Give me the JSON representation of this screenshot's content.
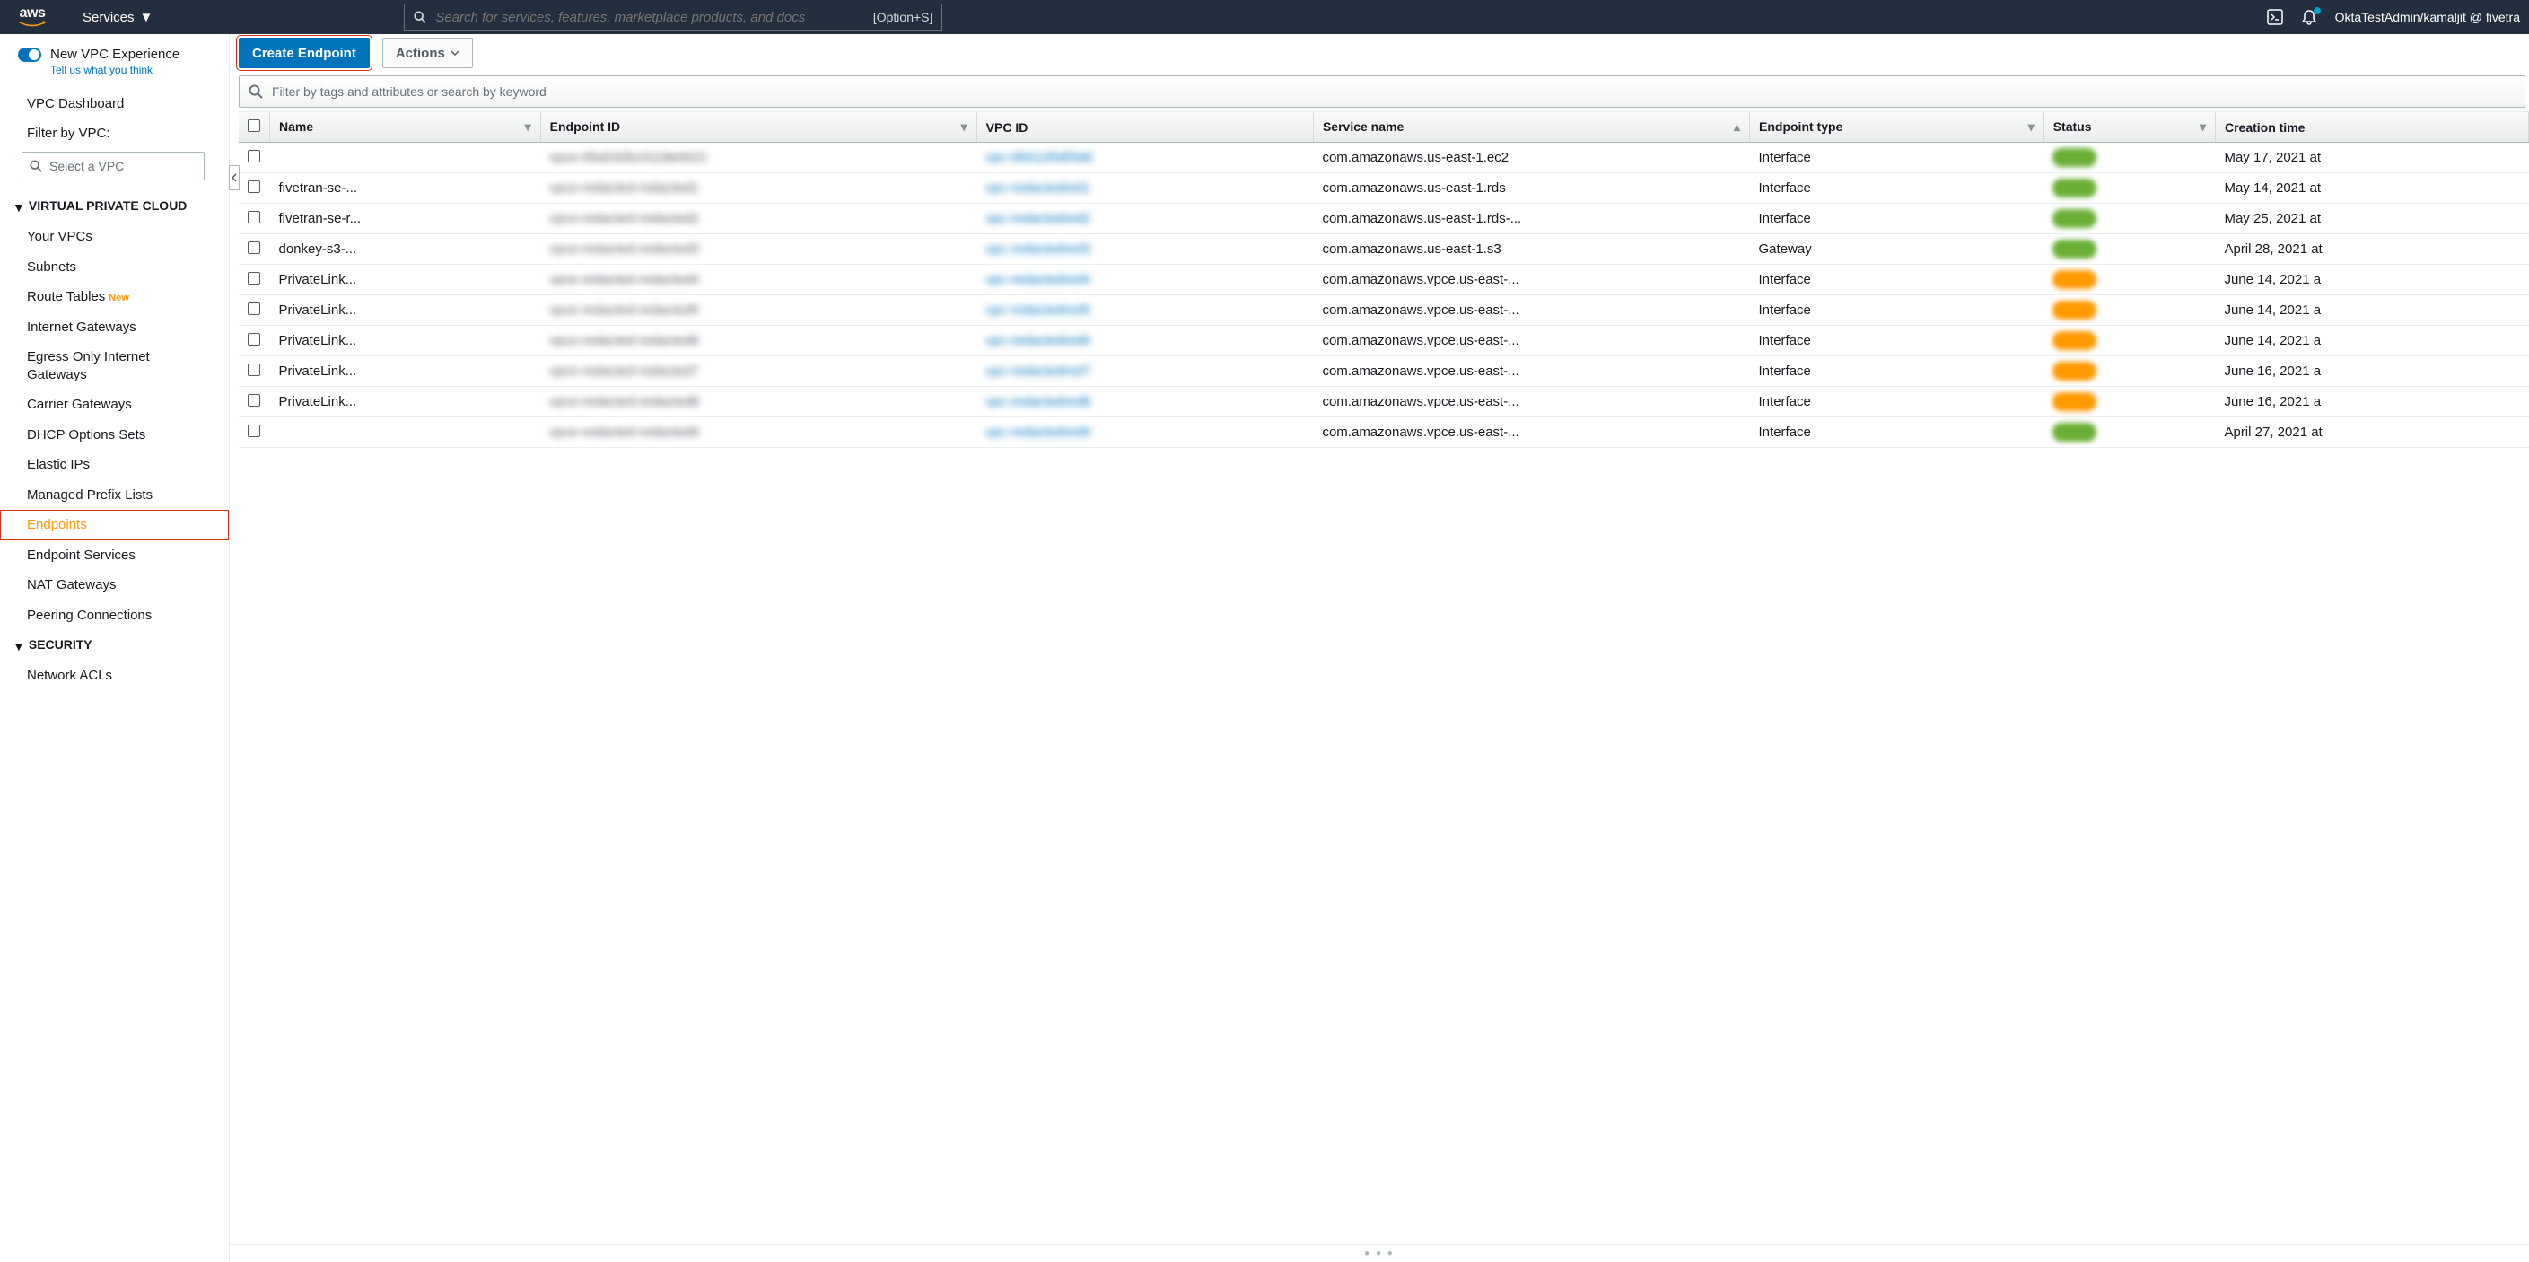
{
  "topnav": {
    "services_label": "Services",
    "search_placeholder": "Search for services, features, marketplace products, and docs",
    "search_shortcut": "[Option+S]",
    "account_label": "OktaTestAdmin/kamaljit @ fivetra"
  },
  "sidebar": {
    "new_experience_label": "New VPC Experience",
    "feedback_label": "Tell us what you think",
    "vpc_dashboard": "VPC Dashboard",
    "filter_by_vpc": "Filter by VPC:",
    "select_vpc_placeholder": "Select a VPC",
    "section_vpc": "VIRTUAL PRIVATE CLOUD",
    "items_vpc": [
      {
        "label": "Your VPCs"
      },
      {
        "label": "Subnets"
      },
      {
        "label": "Route Tables",
        "new": true
      },
      {
        "label": "Internet Gateways"
      },
      {
        "label": "Egress Only Internet Gateways"
      },
      {
        "label": "Carrier Gateways"
      },
      {
        "label": "DHCP Options Sets"
      },
      {
        "label": "Elastic IPs"
      },
      {
        "label": "Managed Prefix Lists"
      },
      {
        "label": "Endpoints",
        "active": true
      },
      {
        "label": "Endpoint Services"
      },
      {
        "label": "NAT Gateways"
      },
      {
        "label": "Peering Connections"
      }
    ],
    "section_security": "SECURITY",
    "items_security": [
      {
        "label": "Network ACLs"
      }
    ],
    "new_badge": "New"
  },
  "actions": {
    "create_endpoint": "Create Endpoint",
    "actions_label": "Actions"
  },
  "filter": {
    "placeholder": "Filter by tags and attributes or search by keyword"
  },
  "table": {
    "headers": {
      "name": "Name",
      "endpoint_id": "Endpoint ID",
      "vpc_id": "VPC ID",
      "service_name": "Service name",
      "endpoint_type": "Endpoint type",
      "status": "Status",
      "creation_time": "Creation time"
    },
    "rows": [
      {
        "name": "",
        "endpoint_id": "vpce-05a532bc0118e0021",
        "vpc_id": "vpc-0b511f0df3dd",
        "service": "com.amazonaws.us-east-1.ec2",
        "type": "Interface",
        "status": "green",
        "created": "May 17, 2021 at"
      },
      {
        "name": "fivetran-se-...",
        "endpoint_id": "vpce-redacted-redacted1",
        "vpc_id": "vpc-redactedred1",
        "service": "com.amazonaws.us-east-1.rds",
        "type": "Interface",
        "status": "green",
        "created": "May 14, 2021 at"
      },
      {
        "name": "fivetran-se-r...",
        "endpoint_id": "vpce-redacted-redacted2",
        "vpc_id": "vpc-redactedred2",
        "service": "com.amazonaws.us-east-1.rds-...",
        "type": "Interface",
        "status": "green",
        "created": "May 25, 2021 at"
      },
      {
        "name": "donkey-s3-...",
        "endpoint_id": "vpce-redacted-redacted3",
        "vpc_id": "vpc-redactedred3",
        "service": "com.amazonaws.us-east-1.s3",
        "type": "Gateway",
        "status": "green",
        "created": "April 28, 2021 at"
      },
      {
        "name": "PrivateLink...",
        "endpoint_id": "vpce-redacted-redacted4",
        "vpc_id": "vpc-redactedred4",
        "service": "com.amazonaws.vpce.us-east-...",
        "type": "Interface",
        "status": "orange",
        "created": "June 14, 2021 a"
      },
      {
        "name": "PrivateLink...",
        "endpoint_id": "vpce-redacted-redacted5",
        "vpc_id": "vpc-redactedred5",
        "service": "com.amazonaws.vpce.us-east-...",
        "type": "Interface",
        "status": "orange",
        "created": "June 14, 2021 a"
      },
      {
        "name": "PrivateLink...",
        "endpoint_id": "vpce-redacted-redacted6",
        "vpc_id": "vpc-redactedred6",
        "service": "com.amazonaws.vpce.us-east-...",
        "type": "Interface",
        "status": "orange",
        "created": "June 14, 2021 a"
      },
      {
        "name": "PrivateLink...",
        "endpoint_id": "vpce-redacted-redacted7",
        "vpc_id": "vpc-redactedred7",
        "service": "com.amazonaws.vpce.us-east-...",
        "type": "Interface",
        "status": "orange",
        "created": "June 16, 2021 a"
      },
      {
        "name": "PrivateLink...",
        "endpoint_id": "vpce-redacted-redacted8",
        "vpc_id": "vpc-redactedred8",
        "service": "com.amazonaws.vpce.us-east-...",
        "type": "Interface",
        "status": "orange",
        "created": "June 16, 2021 a"
      },
      {
        "name": "",
        "endpoint_id": "vpce-redacted-redacted9",
        "vpc_id": "vpc-redactedred9",
        "service": "com.amazonaws.vpce.us-east-...",
        "type": "Interface",
        "status": "green",
        "created": "April 27, 2021 at"
      }
    ]
  }
}
